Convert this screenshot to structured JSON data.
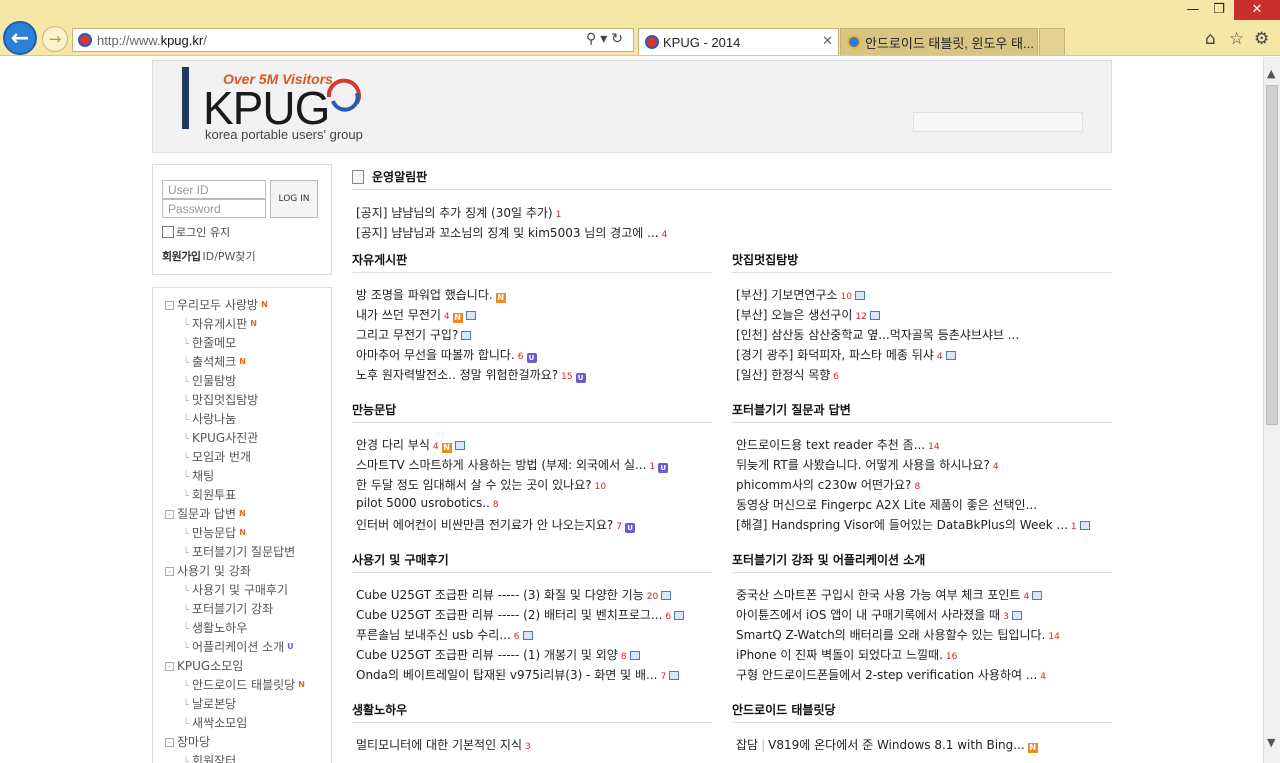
{
  "browser": {
    "url_prefix": "http://www.",
    "url_domain": "kpug.kr",
    "url_suffix": "/",
    "tabs": [
      {
        "title": "KPUG - 2014"
      },
      {
        "title": "안드로이드 태블릿, 윈도우 태..."
      }
    ]
  },
  "header": {
    "logo_tagline": "Over 5M Visitors",
    "logo_text": "KPUG",
    "logo_subtitle": "korea portable users' group"
  },
  "login": {
    "user_id_placeholder": "User ID",
    "password_placeholder": "Password",
    "login_button": "LOG IN",
    "keep_login": "로그인 유지",
    "signup": "회원가입",
    "find": "ID/PW찾기"
  },
  "menu": [
    {
      "label": "우리모두 사랑방",
      "type": "cat",
      "badge": "N"
    },
    {
      "label": "자유게시판",
      "type": "sub",
      "badge": "N"
    },
    {
      "label": "한줄메모",
      "type": "sub"
    },
    {
      "label": "출석체크",
      "type": "sub",
      "badge": "N"
    },
    {
      "label": "인물탐방",
      "type": "sub"
    },
    {
      "label": "맛집멋집탐방",
      "type": "sub"
    },
    {
      "label": "사랑나눔",
      "type": "sub"
    },
    {
      "label": "KPUG사진관",
      "type": "sub"
    },
    {
      "label": "모임과 번개",
      "type": "sub"
    },
    {
      "label": "채팅",
      "type": "sub"
    },
    {
      "label": "회원투표",
      "type": "sub"
    },
    {
      "label": "질문과 답변",
      "type": "cat",
      "badge": "N"
    },
    {
      "label": "만능문답",
      "type": "sub",
      "badge": "N"
    },
    {
      "label": "포터블기기 질문답변",
      "type": "sub"
    },
    {
      "label": "사용기 및 강좌",
      "type": "cat"
    },
    {
      "label": "사용기 및 구매후기",
      "type": "sub"
    },
    {
      "label": "포터블기기 강좌",
      "type": "sub"
    },
    {
      "label": "생활노하우",
      "type": "sub"
    },
    {
      "label": "어플리케이션 소개",
      "type": "sub",
      "badge": "U"
    },
    {
      "label": "KPUG소모임",
      "type": "cat"
    },
    {
      "label": "안드로이드 태블릿당",
      "type": "sub",
      "badge": "N"
    },
    {
      "label": "날로본당",
      "type": "sub"
    },
    {
      "label": "새싹소모임",
      "type": "sub"
    },
    {
      "label": "장마당",
      "type": "cat"
    },
    {
      "label": "회원장터",
      "type": "sub"
    }
  ],
  "notice": {
    "title": "운영알림판",
    "posts": [
      {
        "text": "[공지] 냠냠님의 추가 징계 (30일 추가)",
        "count": "1"
      },
      {
        "text": "[공지] 냠냠님과 꼬소님의 징계 및 kim5003 님의 경고에 ...",
        "count": "4"
      }
    ]
  },
  "sections": [
    {
      "title": "자유게시판",
      "posts": [
        {
          "text": "방 조명을 파워업 했습니다.",
          "icons": [
            "n"
          ]
        },
        {
          "text": "내가 쓰던 무전기",
          "count": "4",
          "icons": [
            "n",
            "img"
          ]
        },
        {
          "text": "그리고 무전기 구입?",
          "icons": [
            "img"
          ]
        },
        {
          "text": "아마추어 무선을 따볼까 합니다.",
          "count": "6",
          "icons": [
            "u"
          ]
        },
        {
          "text": "노후 원자력발전소.. 정말 위험한걸까요?",
          "count": "15",
          "icons": [
            "u"
          ]
        }
      ]
    },
    {
      "title": "맛집멋집탐방",
      "posts": [
        {
          "text": "[부산] 기보면연구소",
          "count": "10",
          "icons": [
            "img"
          ]
        },
        {
          "text": "[부산] 오늘은 생선구이",
          "count": "12",
          "icons": [
            "img"
          ]
        },
        {
          "text": "[인천] 삼산동 삼산중학교 옆...먹자골목 등촌샤브샤브 ..."
        },
        {
          "text": "[경기 광주] 화덕피자, 파스타 메종 뒤샤",
          "count": "4",
          "icons": [
            "img"
          ]
        },
        {
          "text": "[일산] 한정식 목향",
          "count": "6"
        }
      ]
    },
    {
      "title": "만능문답",
      "posts": [
        {
          "text": "안경 다리 부식",
          "count": "4",
          "icons": [
            "n",
            "img"
          ]
        },
        {
          "text": "스마트TV 스마트하게 사용하는 방법 (부제: 외국에서 실...",
          "count": "1",
          "icons": [
            "u"
          ]
        },
        {
          "text": "한 두달 정도 임대해서 살 수 있는 곳이 있나요?",
          "count": "10"
        },
        {
          "text": "pilot 5000 usrobotics..",
          "count": "8"
        },
        {
          "text": "인터버 에어컨이 비싼만큼 전기료가 안 나오는지요?",
          "count": "7",
          "icons": [
            "u"
          ]
        }
      ]
    },
    {
      "title": "포터블기기 질문과 답변",
      "posts": [
        {
          "text": "안드로이드용 text reader 추천 좀...",
          "count": "14"
        },
        {
          "text": "뒤늦게 RT를 사봤습니다. 어떻게 사용을 하시나요?",
          "count": "4"
        },
        {
          "text": "phicomm사의 c230w 어떤가요?",
          "count": "8"
        },
        {
          "text": "동영상 머신으로 Fingerpc A2X Lite 제품이 좋은 선택인..."
        },
        {
          "text": "[해결] Handspring Visor에 들어있는 DataBkPlus의 Week ...",
          "count": "1",
          "icons": [
            "img"
          ]
        }
      ]
    },
    {
      "title": "사용기 및 구매후기",
      "posts": [
        {
          "text": "Cube U25GT 조급판 리뷰 ----- (3) 화질 및 다양한 기능",
          "count": "20",
          "icons": [
            "img"
          ]
        },
        {
          "text": "Cube U25GT 조급판 리뷰 ----- (2) 배터리 및 벤치프로그...",
          "count": "6",
          "icons": [
            "img"
          ]
        },
        {
          "text": "푸른솔님 보내주신 usb 수리...",
          "count": "6",
          "icons": [
            "img"
          ]
        },
        {
          "text": "Cube U25GT 조급판 리뷰 ----- (1) 개봉기 및 외양",
          "count": "8",
          "icons": [
            "img"
          ]
        },
        {
          "text": "Onda의 베이트레일이 탑재된 v975i리뷰(3) - 화면 및 배...",
          "count": "7",
          "icons": [
            "img"
          ]
        }
      ]
    },
    {
      "title": "포터블기기 강좌 및 어플리케이션 소개",
      "posts": [
        {
          "text": "중국산 스마트폰 구입시 한국 사용 가능 여부 체크 포인트",
          "count": "4",
          "icons": [
            "img"
          ]
        },
        {
          "text": "아이튠즈에서 iOS 앱이 내 구매기록에서 사라졌을 때",
          "count": "3",
          "icons": [
            "img"
          ]
        },
        {
          "text": "SmartQ Z-Watch의 배터리를 오래 사용할수 있는 팁입니다.",
          "count": "14"
        },
        {
          "text": "iPhone 이 진짜 벽돌이 되었다고 느낄때.",
          "count": "16"
        },
        {
          "text": "구형 안드로이드폰들에서 2-step verification 사용하여 ...",
          "count": "4"
        }
      ]
    },
    {
      "title": "생활노하우",
      "posts": [
        {
          "text": "멀티모니터에 대한 기본적인 지식",
          "count": "3"
        }
      ]
    },
    {
      "title": "안드로이드 태블릿당",
      "posts": [
        {
          "prefix": "잡담",
          "text": "V819에 온다에서 준 Windows 8.1 with Bing...",
          "icons": [
            "n"
          ]
        }
      ]
    }
  ]
}
